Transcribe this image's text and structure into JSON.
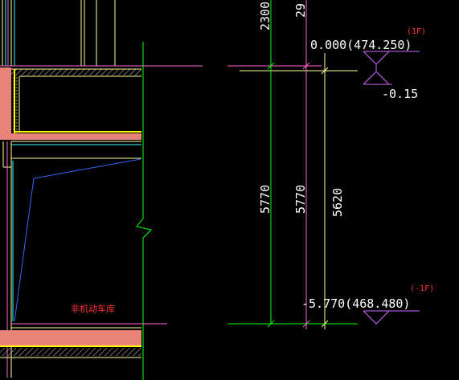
{
  "drawing": {
    "dimensions": {
      "top_partial_1": "2300",
      "top_partial_2": "29",
      "overall_1": "5770",
      "overall_2": "5770",
      "overall_3": "5620"
    },
    "levels": [
      {
        "value": "0.000(474.250)",
        "floor": "(1F)"
      },
      {
        "value": "-0.15"
      },
      {
        "value": "-5.770(468.480)",
        "floor": "(-1F)"
      }
    ],
    "room_label": "非机动车库"
  },
  "colors": {
    "background": "#000000",
    "dimension_line": "#00ff00",
    "axis_line": "#ff66cc",
    "extension_line": "#ffff99",
    "level_symbol": "#cc66ff",
    "wall_fill": "#e8837a",
    "yellow": "#ffff00",
    "blue_leader": "#3366ff",
    "red_text": "#ff3333",
    "text": "#ffffff",
    "cyan": "#33ffff"
  }
}
